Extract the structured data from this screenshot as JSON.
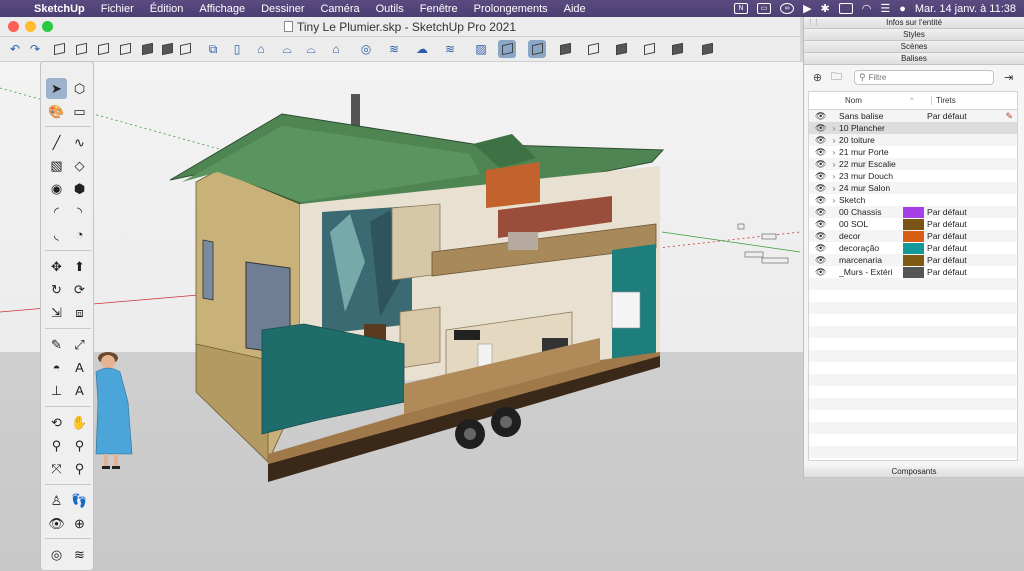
{
  "menubar": {
    "app": "SketchUp",
    "items": [
      "Fichier",
      "Édition",
      "Affichage",
      "Dessiner",
      "Caméra",
      "Outils",
      "Fenêtre",
      "Prolongements",
      "Aide"
    ],
    "clock": "Mar. 14 janv. à 11:38"
  },
  "window": {
    "title": "Tiny Le Plumier.skp - SketchUp Pro 2021"
  },
  "tray": {
    "sections": [
      "Infos sur l'entité",
      "Styles",
      "Scènes",
      "Balises"
    ],
    "search_placeholder": "Filtre",
    "col_name": "Nom",
    "col_dash": "Tirets",
    "components": "Composants",
    "tags": [
      {
        "name": "Sans balise",
        "expandable": false,
        "color": null,
        "dash": "Par défaut",
        "selected": false,
        "active": true
      },
      {
        "name": "10 Plancher",
        "expandable": true,
        "color": null,
        "dash": "",
        "selected": true
      },
      {
        "name": "20 toiture",
        "expandable": true,
        "color": null,
        "dash": ""
      },
      {
        "name": "21 mur Porte",
        "expandable": true,
        "color": null,
        "dash": ""
      },
      {
        "name": "22 mur Escalie",
        "expandable": true,
        "color": null,
        "dash": ""
      },
      {
        "name": "23 mur Douch",
        "expandable": true,
        "color": null,
        "dash": ""
      },
      {
        "name": "24 mur Salon",
        "expandable": true,
        "color": null,
        "dash": ""
      },
      {
        "name": "Sketch",
        "expandable": true,
        "color": null,
        "dash": ""
      },
      {
        "name": "00 Chassis",
        "expandable": false,
        "color": "#a63fe8",
        "dash": "Par défaut"
      },
      {
        "name": "00 SOL",
        "expandable": false,
        "color": "#7a5416",
        "dash": "Par défaut"
      },
      {
        "name": "decor",
        "expandable": false,
        "color": "#d75d12",
        "dash": "Par défaut"
      },
      {
        "name": "decoração",
        "expandable": false,
        "color": "#139a98",
        "dash": "Par défaut"
      },
      {
        "name": "marcenaria",
        "expandable": false,
        "color": "#7f5a12",
        "dash": "Par défaut"
      },
      {
        "name": "_Murs - Extéri",
        "expandable": false,
        "color": "#555555",
        "dash": "Par défaut"
      }
    ]
  },
  "icons": {
    "toolbar": [
      "undo-icon",
      "redo-icon",
      "iso-view-icon",
      "top-view-icon",
      "front-view-icon",
      "right-view-icon",
      "back-view-icon",
      "left-view-icon",
      "bottom-view-icon",
      "xray-icon",
      "back-edges-icon",
      "wireframe-icon",
      "hidden-line-icon",
      "shaded-icon",
      "shaded-textures-icon",
      "monochrome-icon"
    ],
    "palette": [
      "select-icon",
      "component-icon",
      "paint-bucket-icon",
      "eraser-icon",
      "line-icon",
      "freehand-icon",
      "rectangle-icon",
      "rotated-rectangle-icon",
      "circle-icon",
      "polygon-icon",
      "arc-icon",
      "pie-icon",
      "move-icon",
      "push-pull-icon",
      "rotate-icon",
      "follow-me-icon",
      "scale-icon",
      "offset-icon",
      "tape-measure-icon",
      "dimension-icon",
      "protractor-icon",
      "text-icon",
      "axes-icon",
      "3d-text-icon",
      "orbit-icon",
      "pan-icon",
      "zoom-icon",
      "zoom-window-icon",
      "zoom-extents-icon",
      "previous-view-icon",
      "position-camera-icon",
      "walk-icon",
      "look-around-icon",
      "section-plane-icon"
    ]
  }
}
